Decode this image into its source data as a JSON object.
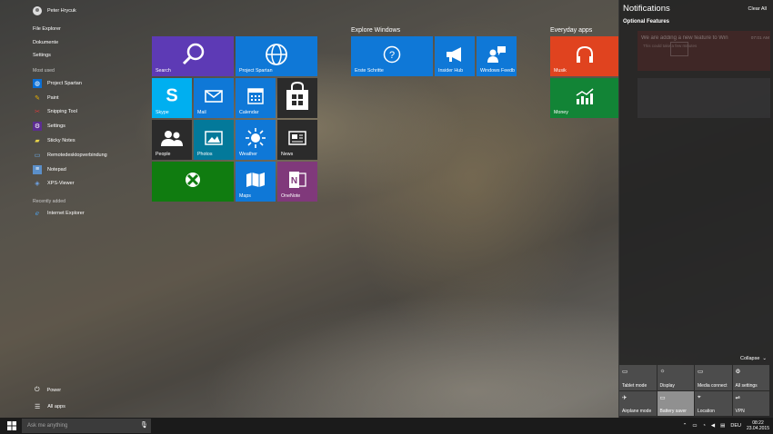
{
  "user": {
    "name": "Peter Hrycuk"
  },
  "pinned": [
    "File Explorer",
    "Dokumente",
    "Settings"
  ],
  "most_used": {
    "header": "Most used",
    "apps": [
      {
        "label": "Project Spartan",
        "icon": "globe-icon",
        "color": "#0a6fd6"
      },
      {
        "label": "Paint",
        "icon": "paint-icon",
        "color": "#e8b100"
      },
      {
        "label": "Snipping Tool",
        "icon": "scissors-icon",
        "color": "#d53c3c"
      },
      {
        "label": "Settings",
        "icon": "gear-icon",
        "color": "#5c2d91"
      },
      {
        "label": "Sticky Notes",
        "icon": "note-icon",
        "color": "#e8d44a"
      },
      {
        "label": "Remotedesktopverbindung",
        "icon": "remote-desktop-icon",
        "color": "#2d7dd2"
      },
      {
        "label": "Notepad",
        "icon": "notepad-icon",
        "color": "#5b8fc9"
      },
      {
        "label": "XPS-Viewer",
        "icon": "xps-icon",
        "color": "#2f6bb5"
      }
    ]
  },
  "recently_added": {
    "header": "Recently added",
    "apps": [
      {
        "label": "Internet Explorer",
        "icon": "ie-icon",
        "color": "#2a7fd4"
      }
    ]
  },
  "bottom": {
    "power": "Power",
    "all_apps": "All apps"
  },
  "groups": {
    "explore": "Explore Windows",
    "everyday": "Everyday apps"
  },
  "tiles": {
    "search": "Search",
    "spartan": "Project Spartan",
    "skype": "Skype",
    "mail": "Mail",
    "calendar": "Calendar",
    "store": "",
    "people": "People",
    "photos": "Photos",
    "weather": "Weather",
    "news": "News",
    "xbox": "",
    "maps": "Maps",
    "onenote": "OneNote",
    "erste": "Erste Schritte",
    "insider": "Insider Hub",
    "feedback": "Windows Feedb",
    "musik": "Musik",
    "money": "Money"
  },
  "colors": {
    "purple": "#5d3ab5",
    "blue": "#0f78d7",
    "skype": "#00aff0",
    "teal": "#03799a",
    "dark": "#2b2b2b",
    "green": "#107c10",
    "onenote": "#80397b",
    "red": "#e0431f",
    "money": "#128436"
  },
  "notifications": {
    "title": "Notifications",
    "clear_all": "Clear All",
    "group": "Optional Features",
    "message": "We are adding a new feature to Win",
    "sub": "This could take a few minutes",
    "time": "07:01 AM",
    "collapse": "Collapse"
  },
  "quick_actions": [
    {
      "label": "Tablet mode",
      "icon": "tablet-icon",
      "on": false
    },
    {
      "label": "Display",
      "icon": "brightness-icon",
      "on": false
    },
    {
      "label": "Media connect",
      "icon": "media-connect-icon",
      "on": false
    },
    {
      "label": "All settings",
      "icon": "gear-icon",
      "on": false
    },
    {
      "label": "Airplane mode",
      "icon": "airplane-icon",
      "on": false
    },
    {
      "label": "Battery saver",
      "icon": "battery-icon",
      "on": true
    },
    {
      "label": "Location",
      "icon": "location-icon",
      "on": false
    },
    {
      "label": "VPN",
      "icon": "vpn-icon",
      "on": false
    }
  ],
  "taskbar": {
    "search_placeholder": "Ask me anything",
    "language": "DEU",
    "time": "08:22",
    "date": "23.04.2015"
  }
}
